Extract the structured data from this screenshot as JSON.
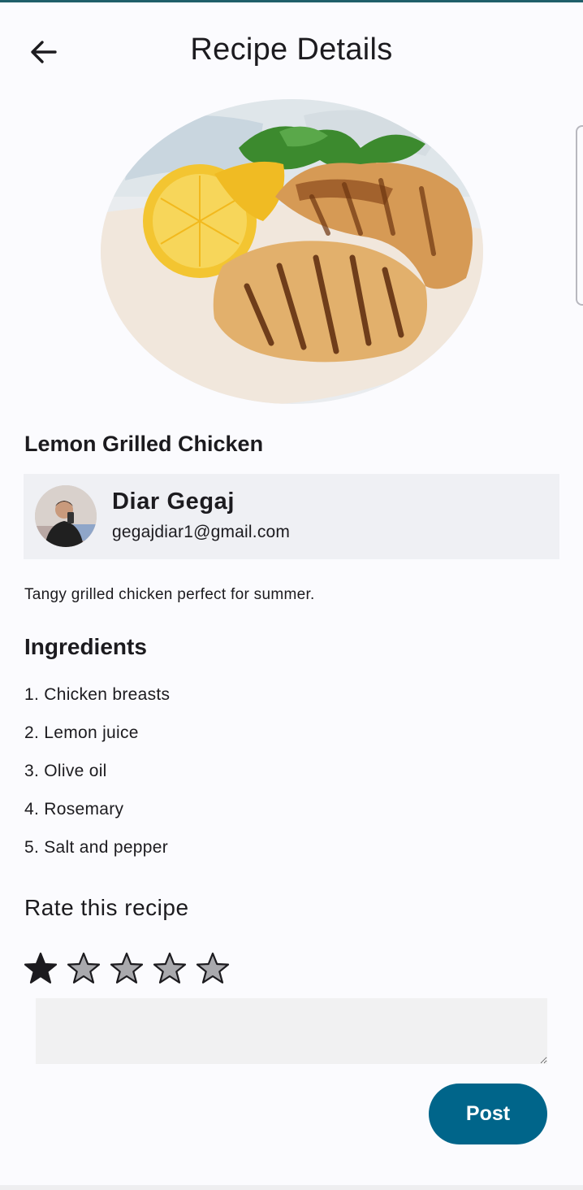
{
  "header": {
    "title": "Recipe Details",
    "back_icon": "arrow-left-icon"
  },
  "recipe": {
    "image": "grilled-chicken-with-lemon-photo",
    "title": "Lemon Grilled Chicken",
    "description": "Tangy grilled chicken perfect for summer."
  },
  "author": {
    "name": "Diar Gegaj",
    "email": "gegajdiar1@gmail.com",
    "avatar": "avatar-photo"
  },
  "ingredients": {
    "title": "Ingredients",
    "items": [
      "1. Chicken breasts",
      "2. Lemon juice",
      "3. Olive oil",
      "4. Rosemary",
      "5. Salt and pepper"
    ]
  },
  "rating": {
    "label": "Rate this recipe",
    "value": 1,
    "max": 5,
    "star_icon": "star-icon"
  },
  "comment": {
    "value": ""
  },
  "post_button": {
    "label": "Post"
  },
  "colors": {
    "accent": "#00658a",
    "background": "#fbfbfe",
    "card": "#eff0f4",
    "star_filled": "#1c1b1f",
    "star_empty": "#a9a9ad"
  }
}
